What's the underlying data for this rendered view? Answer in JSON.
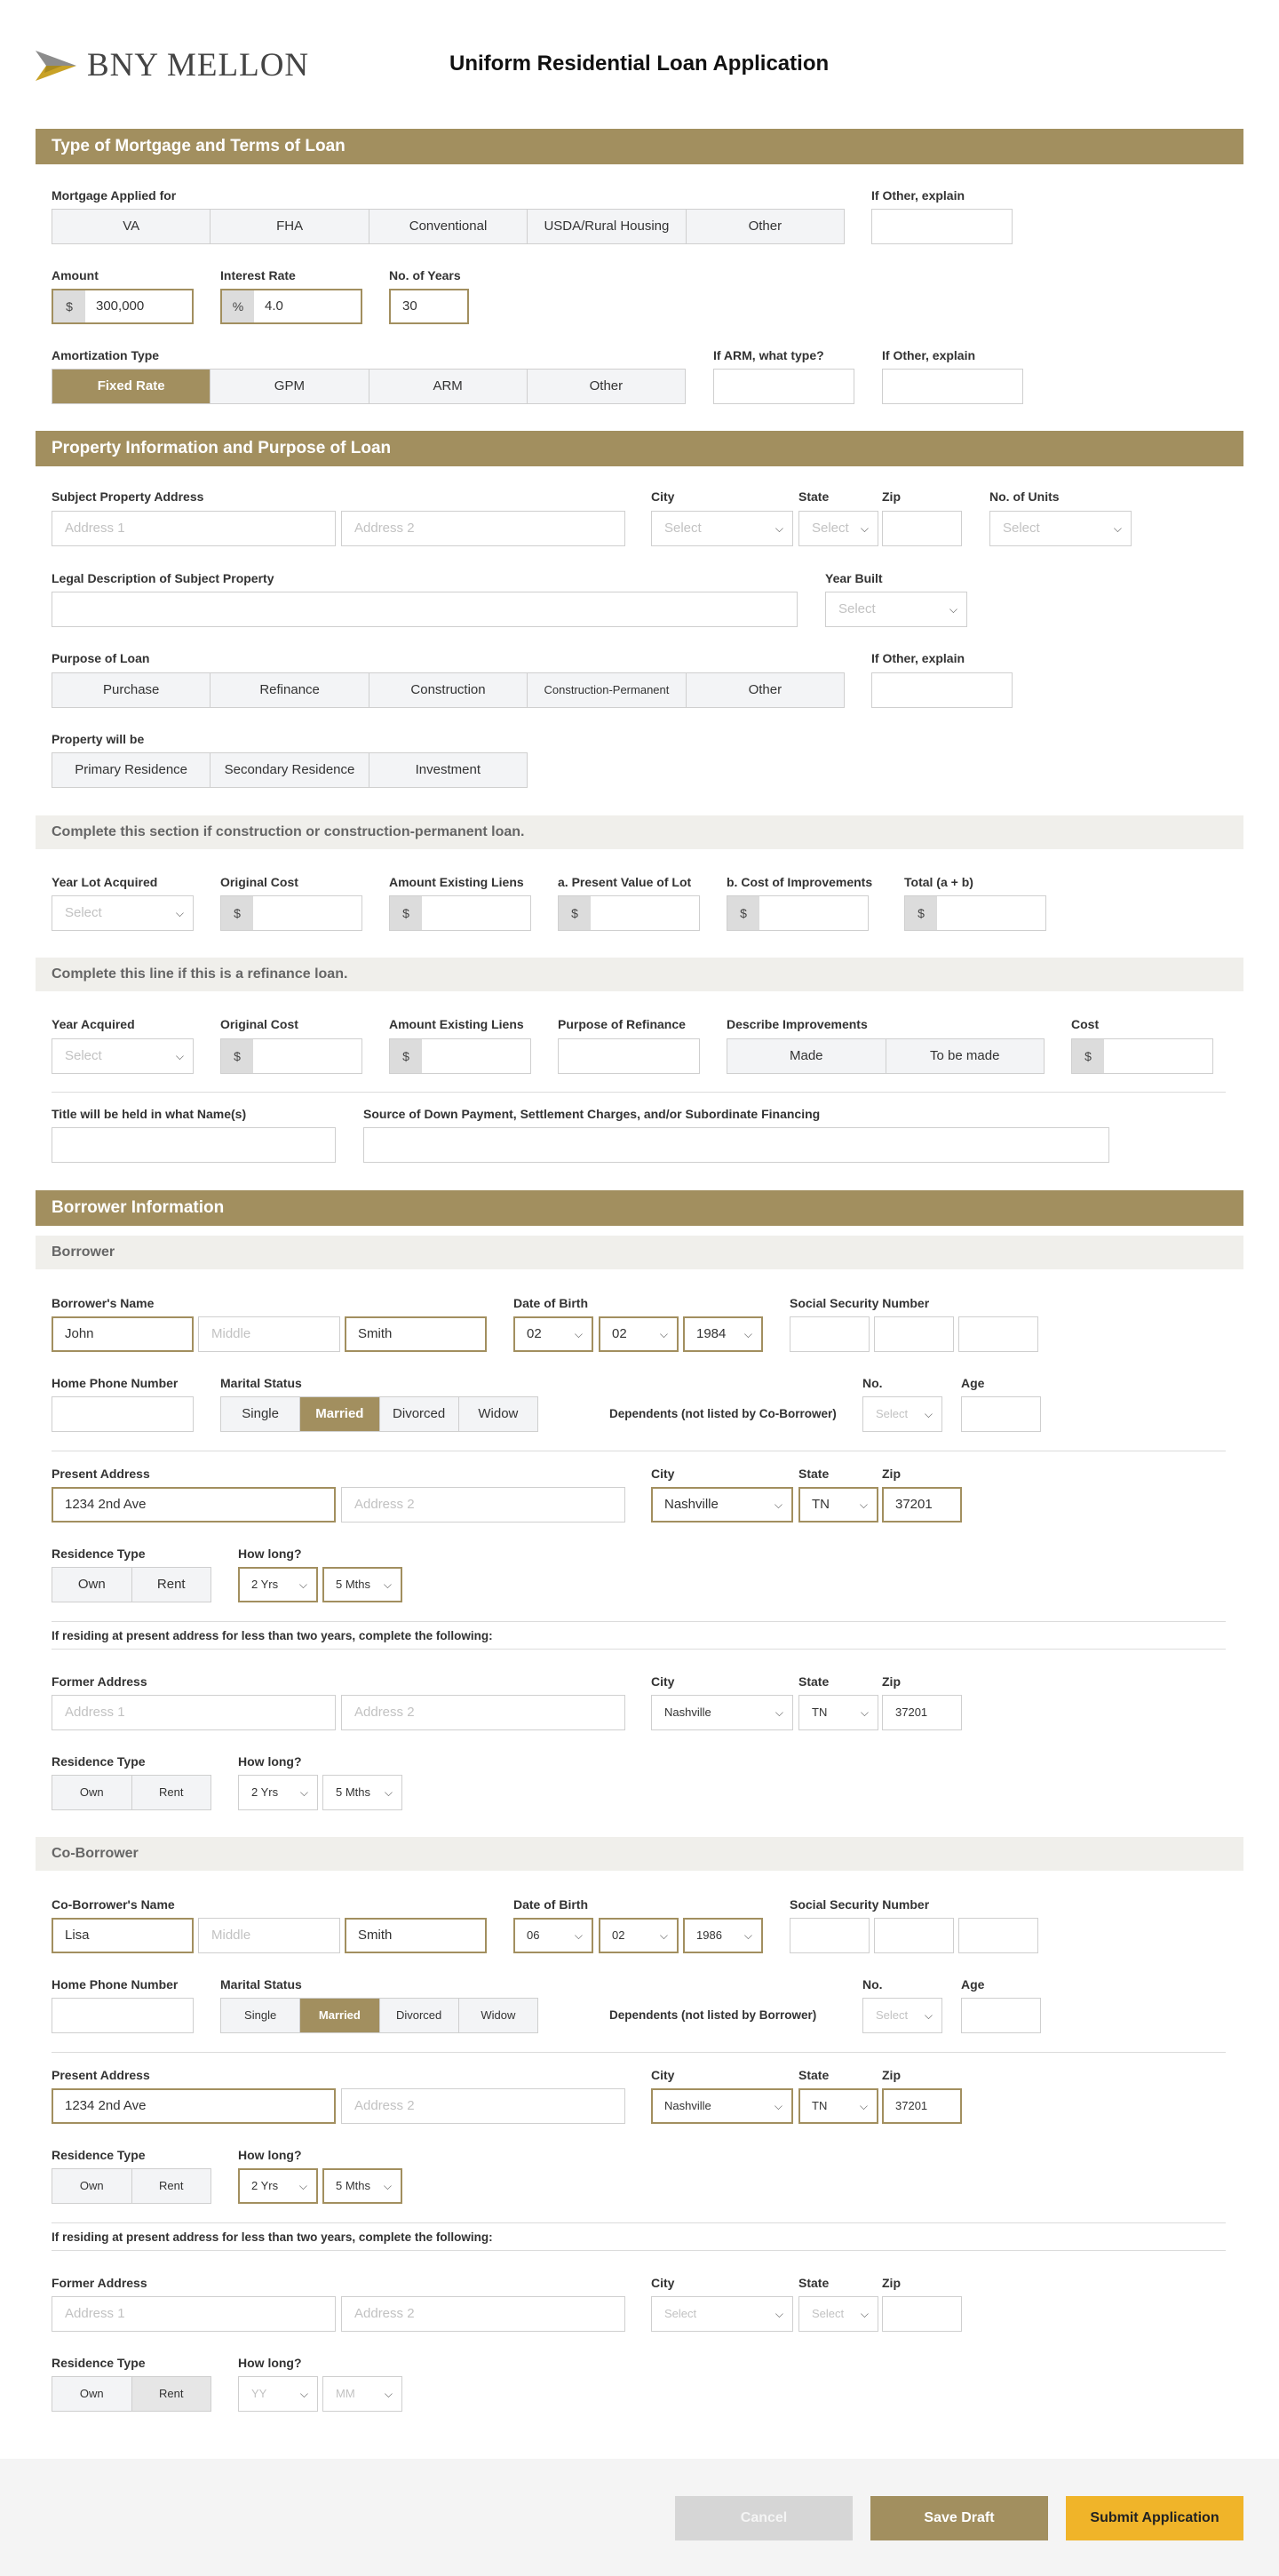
{
  "header": {
    "logo_text": "BNY MELLON",
    "title": "Uniform Residential Loan Application"
  },
  "sections": {
    "mortgage": "Type of Mortgage and Terms of Loan",
    "property": "Property Information and Purpose of Loan",
    "construction": "Complete this section if construction or construction-permanent loan.",
    "refinance": "Complete this line if this is a refinance loan.",
    "borrower_info": "Borrower Information",
    "borrower": "Borrower",
    "coborrower": "Co-Borrower"
  },
  "mortgage": {
    "applied_label": "Mortgage Applied for",
    "applied_options": [
      "VA",
      "FHA",
      "Conventional",
      "USDA/Rural Housing",
      "Other"
    ],
    "other_explain_label": "If Other, explain",
    "amount_label": "Amount",
    "amount_prefix": "$",
    "amount_value": "300,000",
    "rate_label": "Interest Rate",
    "rate_prefix": "%",
    "rate_value": "4.0",
    "years_label": "No. of Years",
    "years_value": "30",
    "amort_label": "Amortization Type",
    "amort_options": [
      "Fixed Rate",
      "GPM",
      "ARM",
      "Other"
    ],
    "amort_selected": "Fixed Rate",
    "arm_label": "If ARM, what type?",
    "amort_other_label": "If Other, explain"
  },
  "property": {
    "address_label": "Subject Property Address",
    "address1_ph": "Address 1",
    "address2_ph": "Address 2",
    "city_label": "City",
    "city_ph": "Select",
    "state_label": "State",
    "state_ph": "Select",
    "zip_label": "Zip",
    "units_label": "No. of Units",
    "units_ph": "Select",
    "legal_label": "Legal Description of Subject Property",
    "year_built_label": "Year Built",
    "year_built_ph": "Select",
    "purpose_label": "Purpose of Loan",
    "purpose_options": [
      "Purchase",
      "Refinance",
      "Construction",
      "Construction-Permanent",
      "Other"
    ],
    "purpose_other_label": "If Other, explain",
    "will_be_label": "Property will be",
    "will_be_options": [
      "Primary Residence",
      "Secondary Residence",
      "Investment"
    ]
  },
  "construction": {
    "year_lot_label": "Year Lot Acquired",
    "year_lot_ph": "Select",
    "orig_cost_label": "Original Cost",
    "liens_label": "Amount Existing Liens",
    "present_value_label": "a. Present Value of Lot",
    "improvements_label": "b. Cost of Improvements",
    "total_label": "Total (a + b)",
    "currency": "$"
  },
  "refinance": {
    "year_acq_label": "Year Acquired",
    "year_acq_ph": "Select",
    "orig_cost_label": "Original Cost",
    "liens_label": "Amount Existing Liens",
    "purpose_label": "Purpose of Refinance",
    "describe_label": "Describe Improvements",
    "describe_options": [
      "Made",
      "To be made"
    ],
    "cost_label": "Cost",
    "currency": "$",
    "title_label": "Title will be held in what Name(s)",
    "source_label": "Source of Down Payment, Settlement Charges, and/or Subordinate Financing"
  },
  "borrower": {
    "name_label": "Borrower's Name",
    "first": "John",
    "middle_ph": "Middle",
    "last": "Smith",
    "dob_label": "Date of Birth",
    "dob_month": "02",
    "dob_day": "02",
    "dob_year": "1984",
    "ssn_label": "Social Security Number",
    "phone_label": "Home Phone Number",
    "marital_label": "Marital Status",
    "marital_options": [
      "Single",
      "Married",
      "Divorced",
      "Widow"
    ],
    "marital_selected": "Married",
    "dependents_label": "Dependents (not listed by Co-Borrower)",
    "no_label": "No.",
    "no_ph": "Select",
    "age_label": "Age",
    "present_label": "Present Address",
    "present1": "1234 2nd Ave",
    "present2_ph": "Address 2",
    "city_label": "City",
    "city": "Nashville",
    "state_label": "State",
    "state": "TN",
    "zip_label": "Zip",
    "zip": "37201",
    "res_type_label": "Residence Type",
    "res_options": [
      "Own",
      "Rent"
    ],
    "how_long_label": "How long?",
    "years": "2 Yrs",
    "months": "5 Mths",
    "notice": "If residing at present address for less than two years, complete the following:",
    "former_label": "Former Address",
    "former1_ph": "Address 1",
    "former2_ph": "Address 2",
    "former_city": "Nashville",
    "former_state": "TN",
    "former_zip": "37201",
    "former_years": "2 Yrs",
    "former_months": "5 Mths"
  },
  "coborrower": {
    "name_label": "Co-Borrower's Name",
    "first": "Lisa",
    "middle_ph": "Middle",
    "last": "Smith",
    "dob_label": "Date of Birth",
    "dob_month": "06",
    "dob_day": "02",
    "dob_year": "1986",
    "ssn_label": "Social Security Number",
    "phone_label": "Home Phone Number",
    "marital_label": "Marital Status",
    "marital_options": [
      "Single",
      "Married",
      "Divorced",
      "Widow"
    ],
    "marital_selected": "Married",
    "dependents_label": "Dependents (not listed by Borrower)",
    "no_label": "No.",
    "no_ph": "Select",
    "age_label": "Age",
    "present_label": "Present Address",
    "present1": "1234 2nd Ave",
    "present2_ph": "Address 2",
    "city_label": "City",
    "city": "Nashville",
    "state_label": "State",
    "state": "TN",
    "zip_label": "Zip",
    "zip": "37201",
    "res_type_label": "Residence Type",
    "res_options": [
      "Own",
      "Rent"
    ],
    "how_long_label": "How long?",
    "years": "2 Yrs",
    "months": "5 Mths",
    "notice": "If residing at present address for less than two years, complete the following:",
    "former_label": "Former Address",
    "former1_ph": "Address 1",
    "former2_ph": "Address 2",
    "former_city_ph": "Select",
    "former_state_ph": "Select",
    "former_years_ph": "YY",
    "former_months_ph": "MM"
  },
  "footer": {
    "cancel": "Cancel",
    "save": "Save Draft",
    "submit": "Submit Application"
  },
  "colors": {
    "accent": "#a28f5f",
    "submit": "#f0b429",
    "cancel": "#d6d6d6"
  }
}
